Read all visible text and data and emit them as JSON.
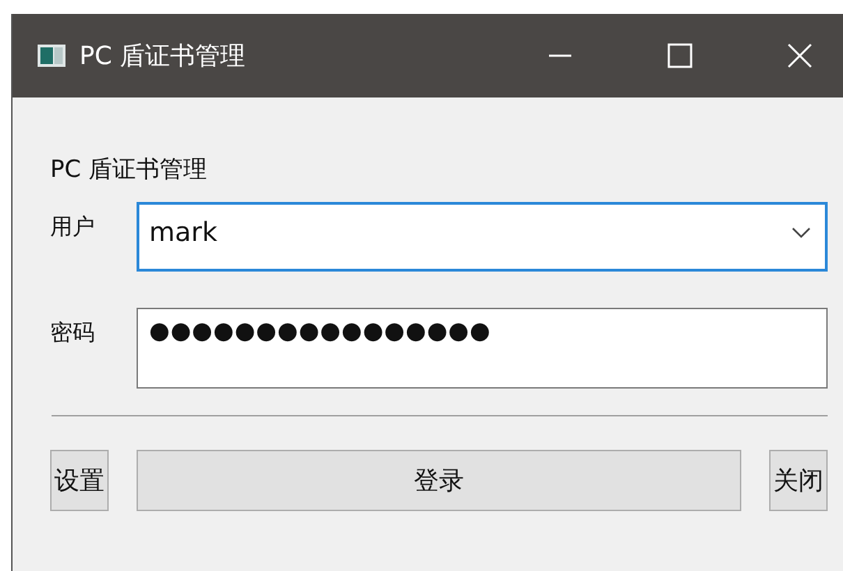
{
  "window": {
    "title": "PC 盾证书管理"
  },
  "heading": "PC 盾证书管理",
  "fields": [
    {
      "kind": "combo",
      "label": "用户",
      "value": "mark",
      "focused": true
    },
    {
      "kind": "password",
      "label": "密码",
      "value": "●●●●●●●●●●●●●●●●",
      "focused": false
    }
  ],
  "buttons": [
    {
      "label": "设置",
      "kind": "small"
    },
    {
      "label": "登录",
      "kind": "wide"
    },
    {
      "label": "关闭",
      "kind": "small"
    }
  ]
}
